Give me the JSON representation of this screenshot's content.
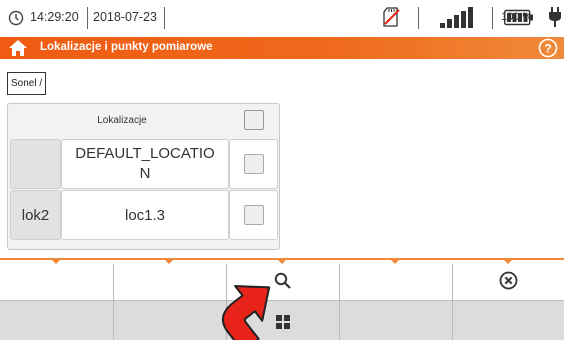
{
  "status": {
    "time": "14:29:20",
    "date": "2018-07-23",
    "battery_percent": "100 %",
    "icons": [
      "clock-icon",
      "sd-card-icon",
      "signal-icon",
      "battery-icon",
      "plug-icon"
    ]
  },
  "header": {
    "title": "Lokalizacje i punkty pomiarowe",
    "icons": [
      "home-icon",
      "help-icon"
    ]
  },
  "breadcrumb": "Sonel /",
  "table": {
    "header": "Lokalizacje",
    "rows": [
      {
        "name": "",
        "value": "DEFAULT_LOCATIO\nN"
      },
      {
        "name": "lok2",
        "value": "loc1.3"
      }
    ]
  },
  "bottom": {
    "row1_icons": [
      "",
      "",
      "search-icon",
      "",
      "close-circle-icon"
    ],
    "row2_icons": [
      "",
      "",
      "grid-icon",
      "",
      ""
    ]
  },
  "colors": {
    "accent": "#f05a12",
    "arrow": "#e8231a"
  }
}
